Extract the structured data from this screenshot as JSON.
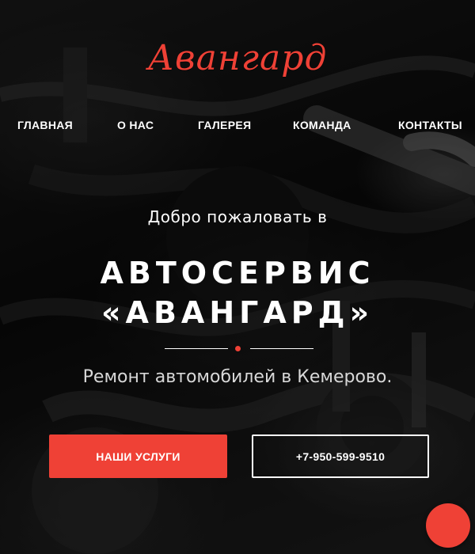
{
  "brand": {
    "logo_text": "Авангард",
    "accent_color": "#ef4136"
  },
  "nav": {
    "items": [
      {
        "label": "ГЛАВНАЯ"
      },
      {
        "label": "О НАС"
      },
      {
        "label": "ГАЛЕРЕЯ"
      },
      {
        "label": "КОМАНДА"
      },
      {
        "label": "КОНТАКТЫ"
      }
    ]
  },
  "hero": {
    "welcome": "Добро пожаловать в",
    "headline_line1": "АВТОСЕРВИС",
    "headline_line2": "«АВАНГАРД»",
    "subtitle": "Ремонт автомобилей в Кемерово."
  },
  "actions": {
    "services_label": "НАШИ УСЛУГИ",
    "phone_label": "+7-950-599-9510"
  }
}
